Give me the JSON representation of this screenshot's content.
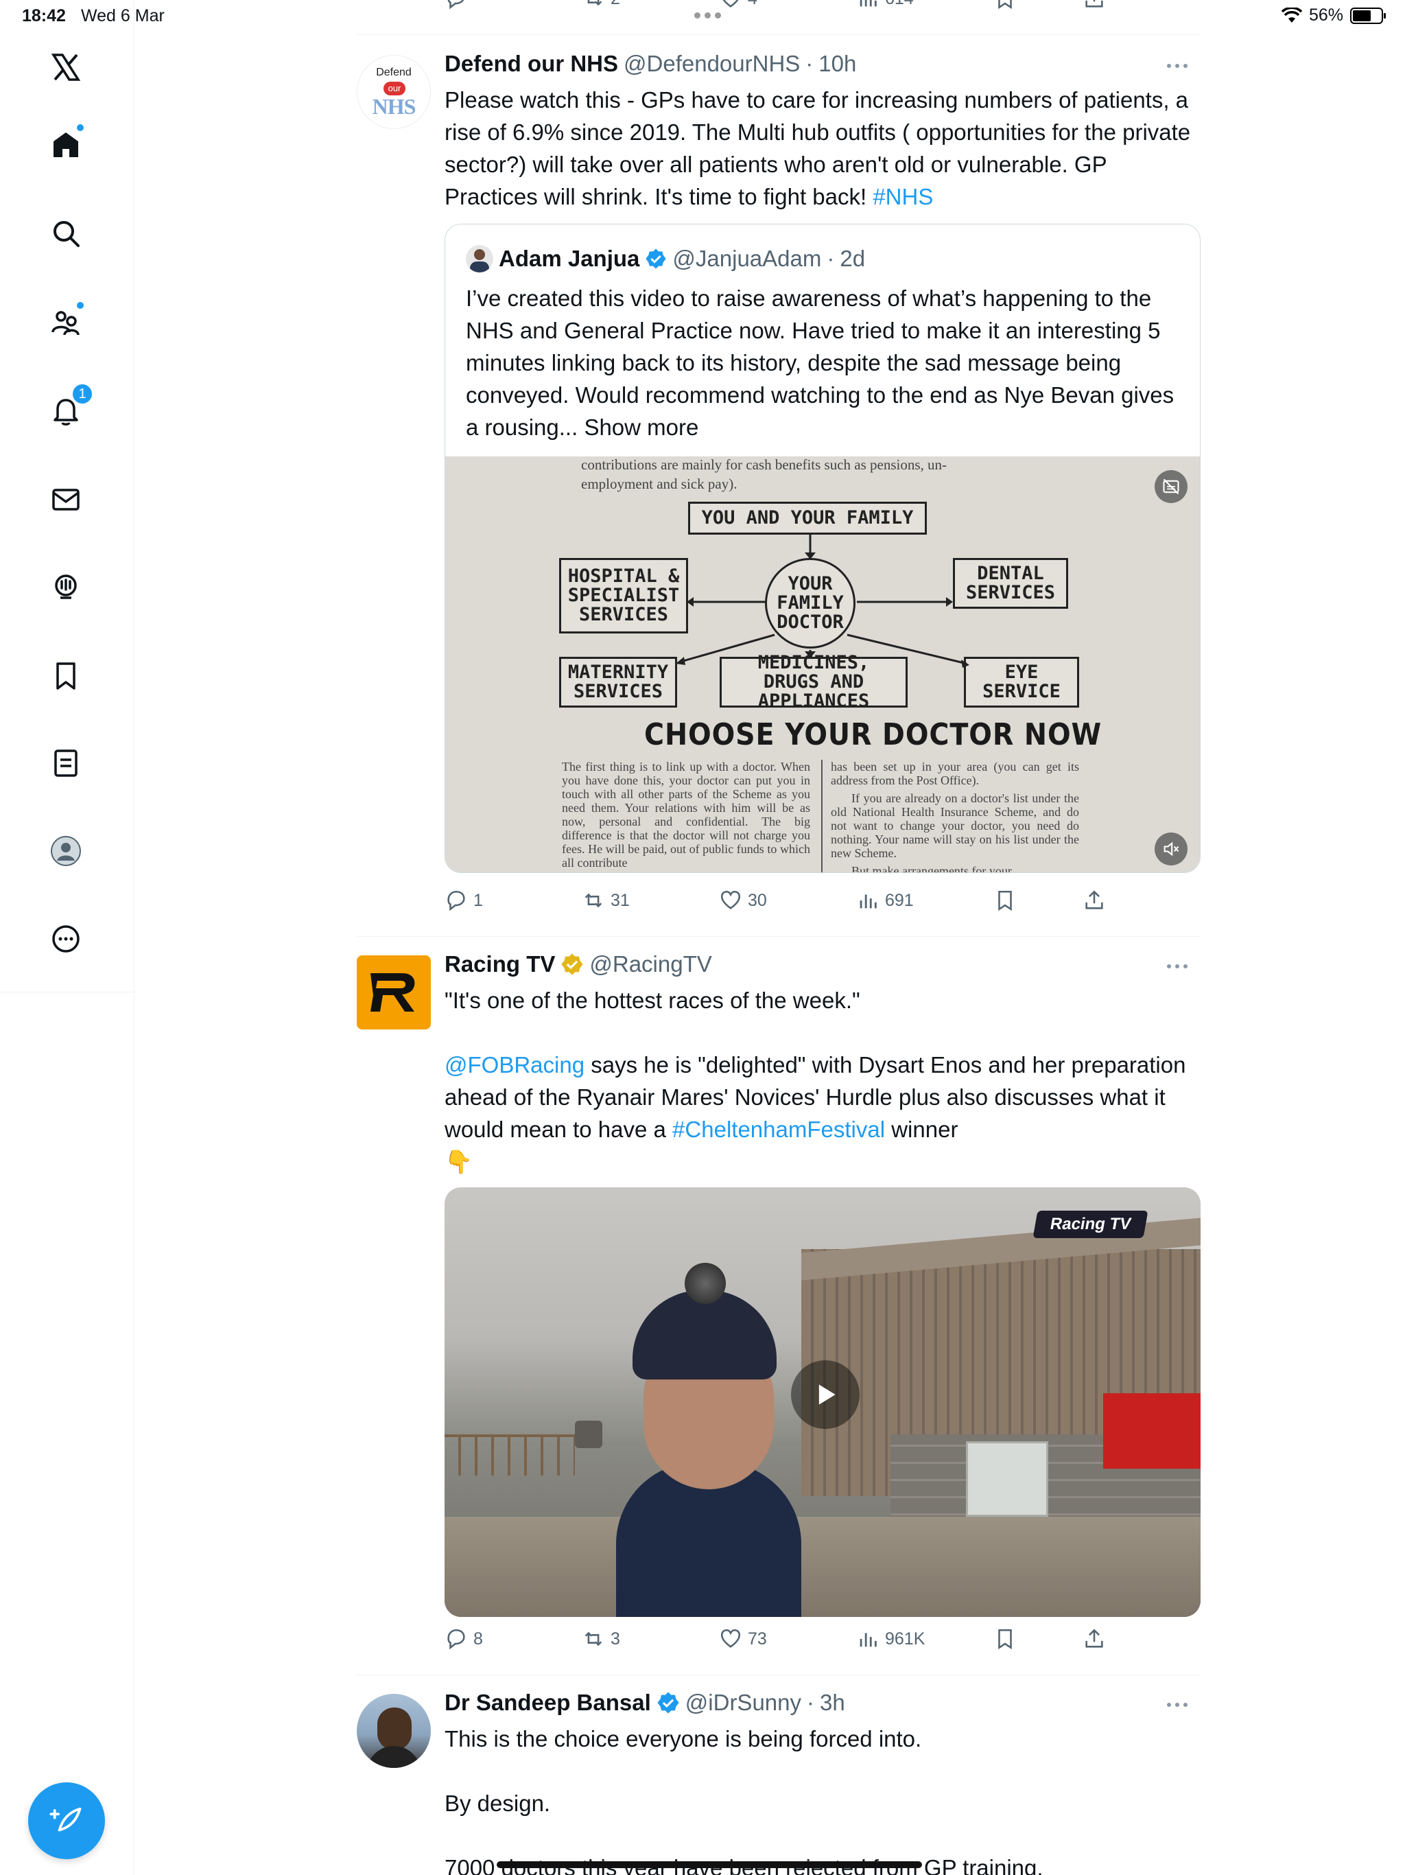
{
  "status_bar": {
    "time": "18:42",
    "date": "Wed 6 Mar",
    "battery": "56%"
  },
  "sidebar": {
    "notifications_badge": "1"
  },
  "top_partial_actions": {
    "retweets": "2",
    "likes": "4",
    "views": "614"
  },
  "tweets": [
    {
      "name": "Defend our NHS",
      "handle": "@DefendourNHS",
      "time": "10h",
      "avatar_text_top": "Defend",
      "avatar_text_mid": "our",
      "avatar_text_bottom": "NHS",
      "text": "Please watch this - GPs have to care for increasing numbers of patients, a rise of 6.9% since 2019. The Multi hub outfits ( opportunities for the private sector?) will take over all patients who aren't old or vulnerable. GP Practices will shrink. It's time to fight back! ",
      "hashtag": "#NHS",
      "quote": {
        "name": "Adam Janjua",
        "handle": "@JanjuaAdam",
        "time": "2d",
        "text": "I’ve created this video to raise awareness of what’s happening to the NHS and General Practice now. Have tried to make it an interesting 5 minutes linking back to its history, despite the sad message being conveyed. Would recommend watching to the end as Nye Bevan gives a rousing...",
        "show_more": "Show more",
        "doc": {
          "top_line_1": "contributions are mainly for cash benefits such as pensions, un-",
          "top_line_2": "employment and sick pay).",
          "you_and_family": "YOU AND YOUR FAMILY",
          "your_doctor": "YOUR FAMILY DOCTOR",
          "hospital": "HOSPITAL & SPECIALIST SERVICES",
          "dental": "DENTAL SERVICES",
          "maternity": "MATERNITY SERVICES",
          "medicines": "MEDICINES, DRUGS AND APPLIANCES",
          "eye": "EYE SERVICE",
          "heading": "CHOOSE YOUR DOCTOR NOW",
          "col_left": "The first thing is to link up with a doctor. When you have done this, your doctor can put you in touch with all other parts of the Scheme as you need them. Your relations with him will be as now, personal and confidential. The big difference is that the doctor will not charge you fees. He will be paid, out of public funds to which all contribute",
          "col_right_1": "has been set up in your area (you can get its address from the Post Office).",
          "col_right_2": "If you are already on a doctor's list under the old National Health Insurance Scheme, and do not want to change your doctor, you need do nothing. Your name will stay on his list under the new Scheme.",
          "col_right_3": "But make arrangements for your"
        }
      },
      "actions": {
        "replies": "1",
        "retweets": "31",
        "likes": "30",
        "views": "691"
      }
    },
    {
      "name": "Racing TV",
      "handle": "@RacingTV",
      "text_1": "\"It's one of the hottest races of the week.\"",
      "mention": "@FOBRacing",
      "text_2a": " says he is \"delighted\" with Dysart Enos and her preparation ahead of the Ryanair Mares' Novices' Hurdle plus also discusses what it would mean to have a ",
      "hashtag": "#CheltenhamFestival",
      "text_2b": " winner",
      "emoji": "👇",
      "video_logo": "Racing TV",
      "actions": {
        "replies": "8",
        "retweets": "3",
        "likes": "73",
        "views": "961K"
      }
    },
    {
      "name": "Dr Sandeep Bansal",
      "handle": "@iDrSunny",
      "time": "3h",
      "line_1": "This is the choice everyone is being forced into.",
      "line_2": "By design.",
      "line_3": "7000 doctors this year have been rejected from GP training."
    }
  ],
  "colors": {
    "accent": "#1d9bf0",
    "text": "#0f1419",
    "muted": "#536471",
    "verified_gold": "#e2b719",
    "racing_orange": "#f5a000"
  }
}
